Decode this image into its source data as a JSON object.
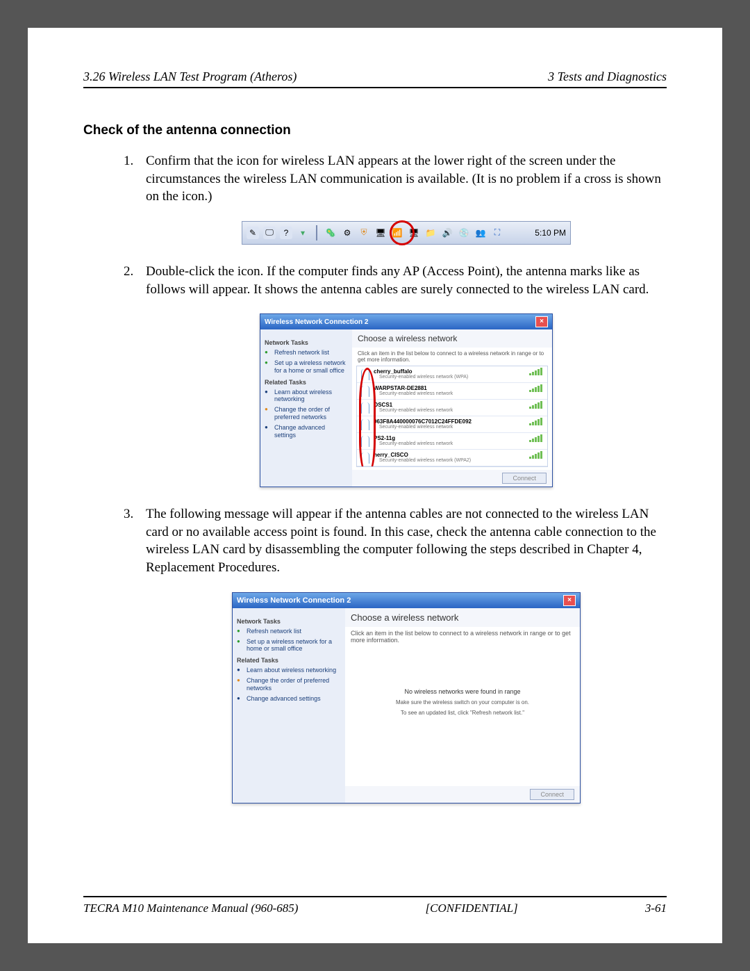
{
  "header": {
    "left": "3.26 Wireless LAN Test Program (Atheros)",
    "right": "3 Tests and Diagnostics"
  },
  "section_title": "Check of the antenna connection",
  "steps": {
    "s1": "Confirm that the icon for wireless LAN appears at the lower right of the screen under the circumstances the wireless LAN communication is available. (It is no problem if a cross is shown on the icon.)",
    "s2": "Double-click the icon. If the computer finds any AP (Access Point), the antenna marks like as follows will appear. It shows the antenna cables are surely connected to the wireless LAN card.",
    "s3": "The following message will appear if the antenna cables are not connected to the wireless LAN card or no available access point is found. In this case, check the antenna cable connection to the wireless LAN card by disassembling the computer following the steps described in Chapter 4, Replacement Procedures."
  },
  "taskbar": {
    "time": "5:10 PM"
  },
  "dlg": {
    "title": "Wireless Network Connection 2",
    "choose": "Choose a wireless network",
    "hint": "Click an item in the list below to connect to a wireless network in range or to get more information.",
    "connect": "Connect",
    "sidebar": {
      "h1": "Network Tasks",
      "l1": "Refresh network list",
      "l2": "Set up a wireless network for a home or small office",
      "h2": "Related Tasks",
      "l3": "Learn about wireless networking",
      "l4": "Change the order of preferred networks",
      "l5": "Change advanced settings"
    },
    "networks": [
      {
        "name": "cherry_buffalo",
        "sub": "Security-enabled wireless network (WPA)"
      },
      {
        "name": "WARPSTAR-DE2881",
        "sub": "Security-enabled wireless network"
      },
      {
        "name": "OSCS1",
        "sub": "Security-enabled wireless network"
      },
      {
        "name": "063F8A440000076C7012C24FFDE092",
        "sub": "Security-enabled wireless network"
      },
      {
        "name": "PS2-11g",
        "sub": "Security-enabled wireless network"
      },
      {
        "name": "herry_CISCO",
        "sub": "Security-enabled wireless network (WPA2)"
      }
    ],
    "empty": {
      "title": "No wireless networks were found in range",
      "sub1": "Make sure the wireless switch on your computer is on.",
      "sub2": "To see an updated list, click \"Refresh network list.\""
    }
  },
  "footer": {
    "left": "TECRA M10 Maintenance Manual (960-685)",
    "center": "[CONFIDENTIAL]",
    "right": "3-61"
  }
}
